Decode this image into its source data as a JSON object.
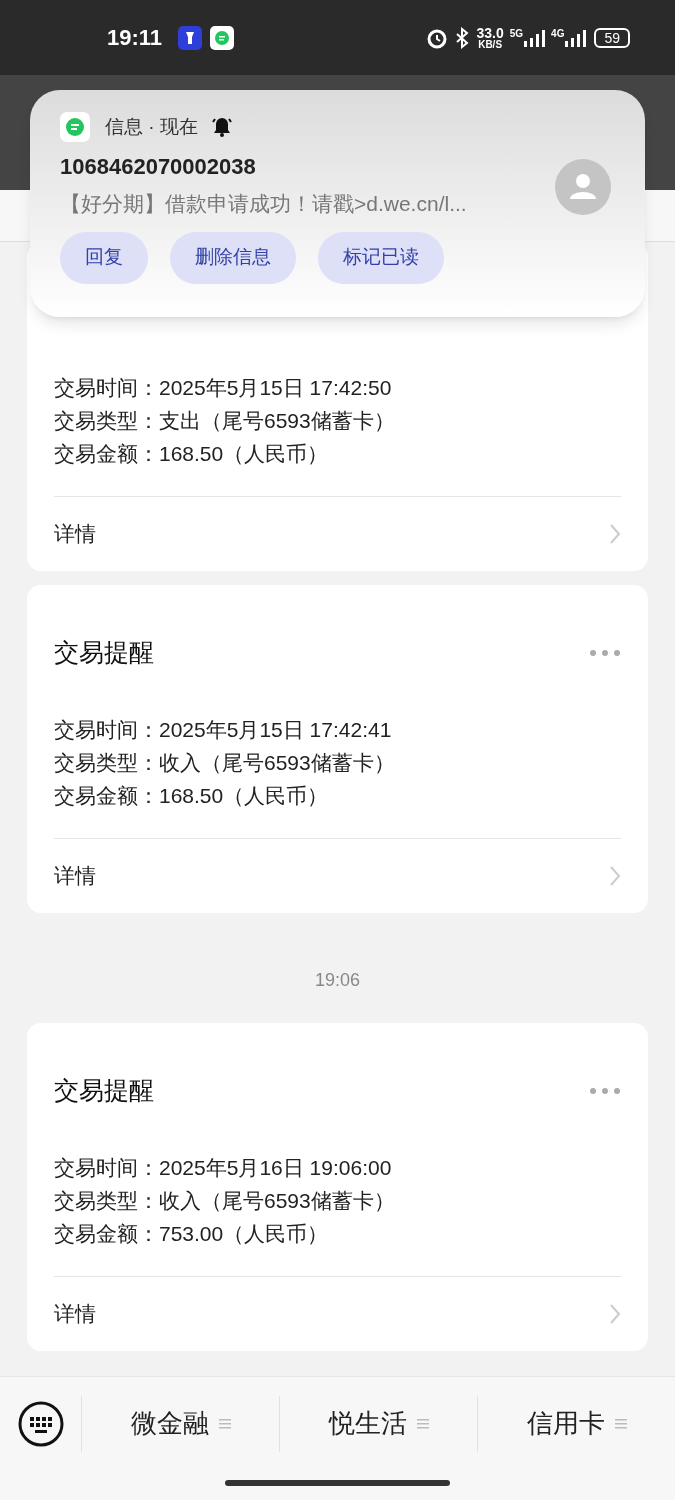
{
  "status_bar": {
    "time": "19:11",
    "net_speed": "33.0",
    "net_unit": "KB/S",
    "network_1": "5G",
    "network_2": "4G",
    "battery": "59"
  },
  "notification": {
    "app": "信息 · 现在",
    "sender": "1068462070002038",
    "message": "【好分期】借款申请成功！请戳>d.we.cn/l...",
    "actions": [
      "回复",
      "删除信息",
      "标记已读"
    ]
  },
  "messages": [
    {
      "kind": "card",
      "lines": [
        "交易时间：2025年5月15日 17:42:50",
        "交易类型：支出（尾号6593储蓄卡）",
        "交易金额：168.50（人民币）"
      ],
      "link": "详情"
    },
    {
      "kind": "card",
      "title": "交易提醒",
      "lines": [
        "交易时间：2025年5月15日 17:42:41",
        "交易类型：收入（尾号6593储蓄卡）",
        "交易金额：168.50（人民币）"
      ],
      "link": "详情"
    },
    {
      "kind": "time",
      "text": "19:06"
    },
    {
      "kind": "card",
      "title": "交易提醒",
      "lines": [
        "交易时间：2025年5月16日 19:06:00",
        "交易类型：收入（尾号6593储蓄卡）",
        "交易金额：753.00（人民币）"
      ],
      "link": "详情"
    }
  ],
  "bottom_menu": [
    "微金融",
    "悦生活",
    "信用卡"
  ]
}
